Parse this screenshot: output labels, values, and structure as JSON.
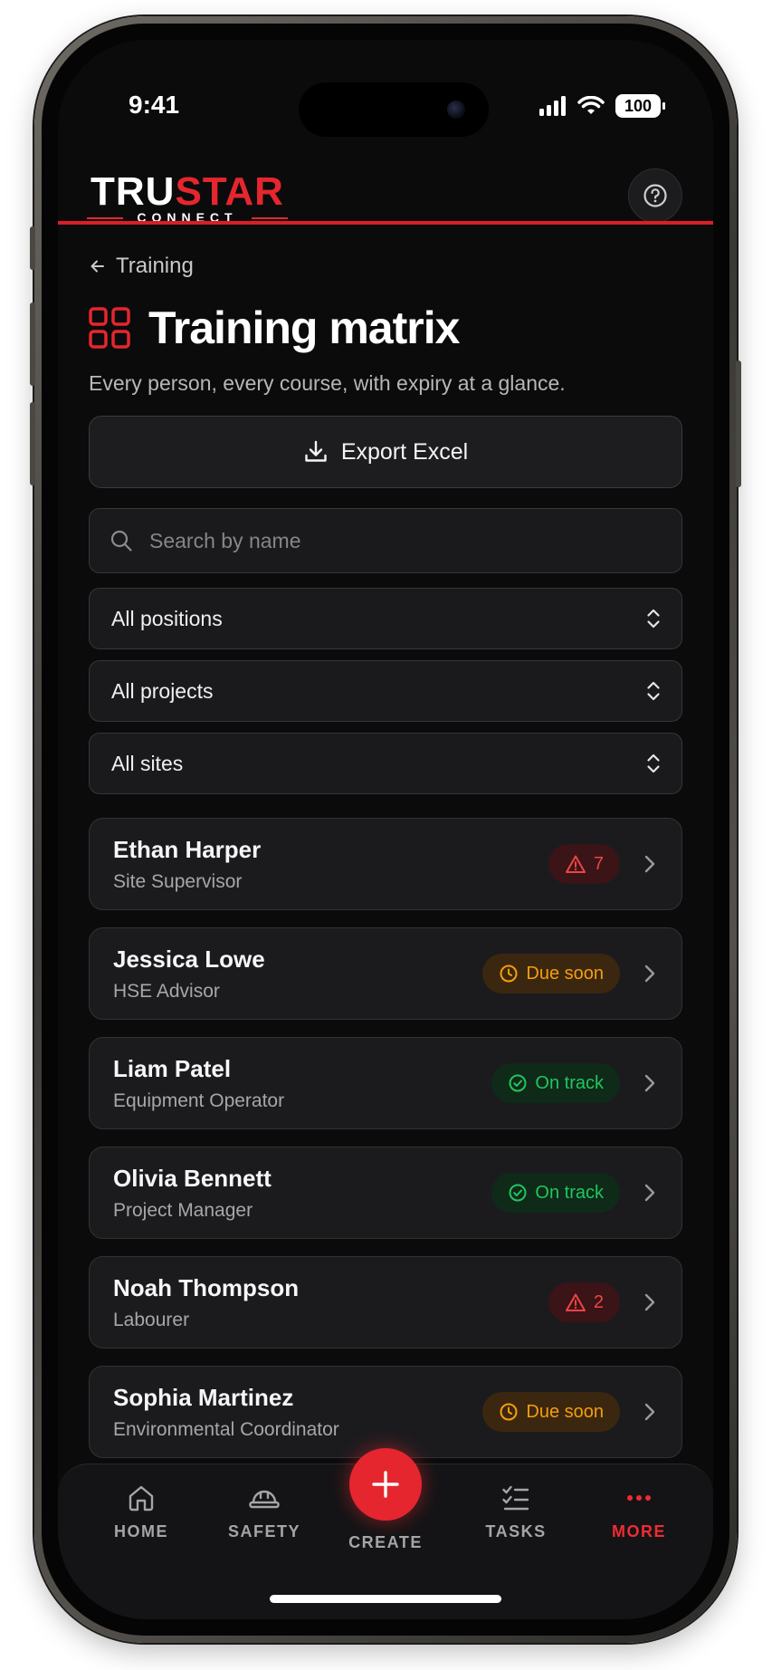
{
  "status": {
    "time": "9:41",
    "battery": "100"
  },
  "brand": {
    "name_part1": "TRU",
    "name_part2": "STAR",
    "sub": "CONNECT"
  },
  "nav": {
    "back_label": "Training"
  },
  "page": {
    "title": "Training matrix",
    "subtitle": "Every person, every course, with expiry at a glance."
  },
  "actions": {
    "export_label": "Export Excel"
  },
  "search": {
    "placeholder": "Search by name",
    "value": ""
  },
  "filters": {
    "positions": "All positions",
    "projects": "All projects",
    "sites": "All sites"
  },
  "people": [
    {
      "name": "Ethan Harper",
      "role": "Site Supervisor",
      "status": "alert",
      "badge": "7"
    },
    {
      "name": "Jessica Lowe",
      "role": "HSE Advisor",
      "status": "due",
      "badge": "Due soon"
    },
    {
      "name": "Liam Patel",
      "role": "Equipment Operator",
      "status": "ok",
      "badge": "On track"
    },
    {
      "name": "Olivia Bennett",
      "role": "Project Manager",
      "status": "ok",
      "badge": "On track"
    },
    {
      "name": "Noah Thompson",
      "role": "Labourer",
      "status": "alert",
      "badge": "2"
    },
    {
      "name": "Sophia Martinez",
      "role": "Environmental Coordinator",
      "status": "due",
      "badge": "Due soon"
    }
  ],
  "tabbar": {
    "home": "HOME",
    "safety": "SAFETY",
    "create": "CREATE",
    "tasks": "TASKS",
    "more": "MORE",
    "active": "more"
  },
  "colors": {
    "accent": "#e5262e",
    "alert": "#ef4444",
    "due": "#f59e0b",
    "ok": "#22c55e",
    "background": "#0b0b0c"
  }
}
